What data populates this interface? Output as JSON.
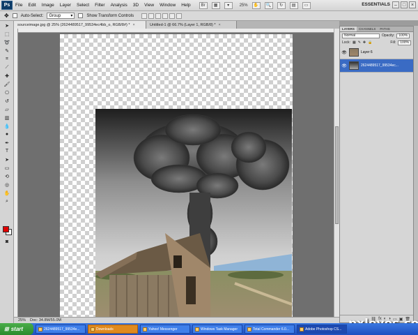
{
  "menubar": {
    "logo": "Ps",
    "items": [
      "File",
      "Edit",
      "Image",
      "Layer",
      "Select",
      "Filter",
      "Analysis",
      "3D",
      "View",
      "Window",
      "Help"
    ],
    "zoom": "25%",
    "workspace": "ESSENTIALS"
  },
  "options": {
    "auto_select_label": "Auto-Select:",
    "auto_select_value": "Group",
    "show_transform_label": "Show Transform Controls"
  },
  "tabs": [
    {
      "label": "sourceimage.jpg @ 25% (2624489517_99534ec4bb_o, RGB/8#) *"
    },
    {
      "label": "Untitled-1 @ 66.7% (Layer 1, RGB/8) *"
    }
  ],
  "status": {
    "zoom": "25%",
    "doc": "Doc: 34.8M/55.0M"
  },
  "layers_panel": {
    "tabs": [
      "LAYERS",
      "CHANNELS",
      "PATHS"
    ],
    "blend_mode": "Normal",
    "opacity_label": "Opacity:",
    "opacity": "100%",
    "lock_label": "Lock:",
    "fill_label": "Fill:",
    "fill": "100%",
    "layers": [
      {
        "name": "Layer 6",
        "selected": false
      },
      {
        "name": "2624489517_99534ec...",
        "selected": true
      }
    ]
  },
  "taskbar": {
    "start": "start",
    "tasks": [
      {
        "label": "2624489517_99534e..."
      },
      {
        "label": "Downloads"
      },
      {
        "label": "Yahoo! Messenger"
      },
      {
        "label": "Windows Task Manager"
      },
      {
        "label": "Total Commander 6.0..."
      },
      {
        "label": "Adobe Photoshop CS..."
      }
    ]
  },
  "watermark": "pxleyes.com",
  "colors": {
    "foreground": "#e00000",
    "background": "#ffffff",
    "selection": "#3a6bc4"
  }
}
